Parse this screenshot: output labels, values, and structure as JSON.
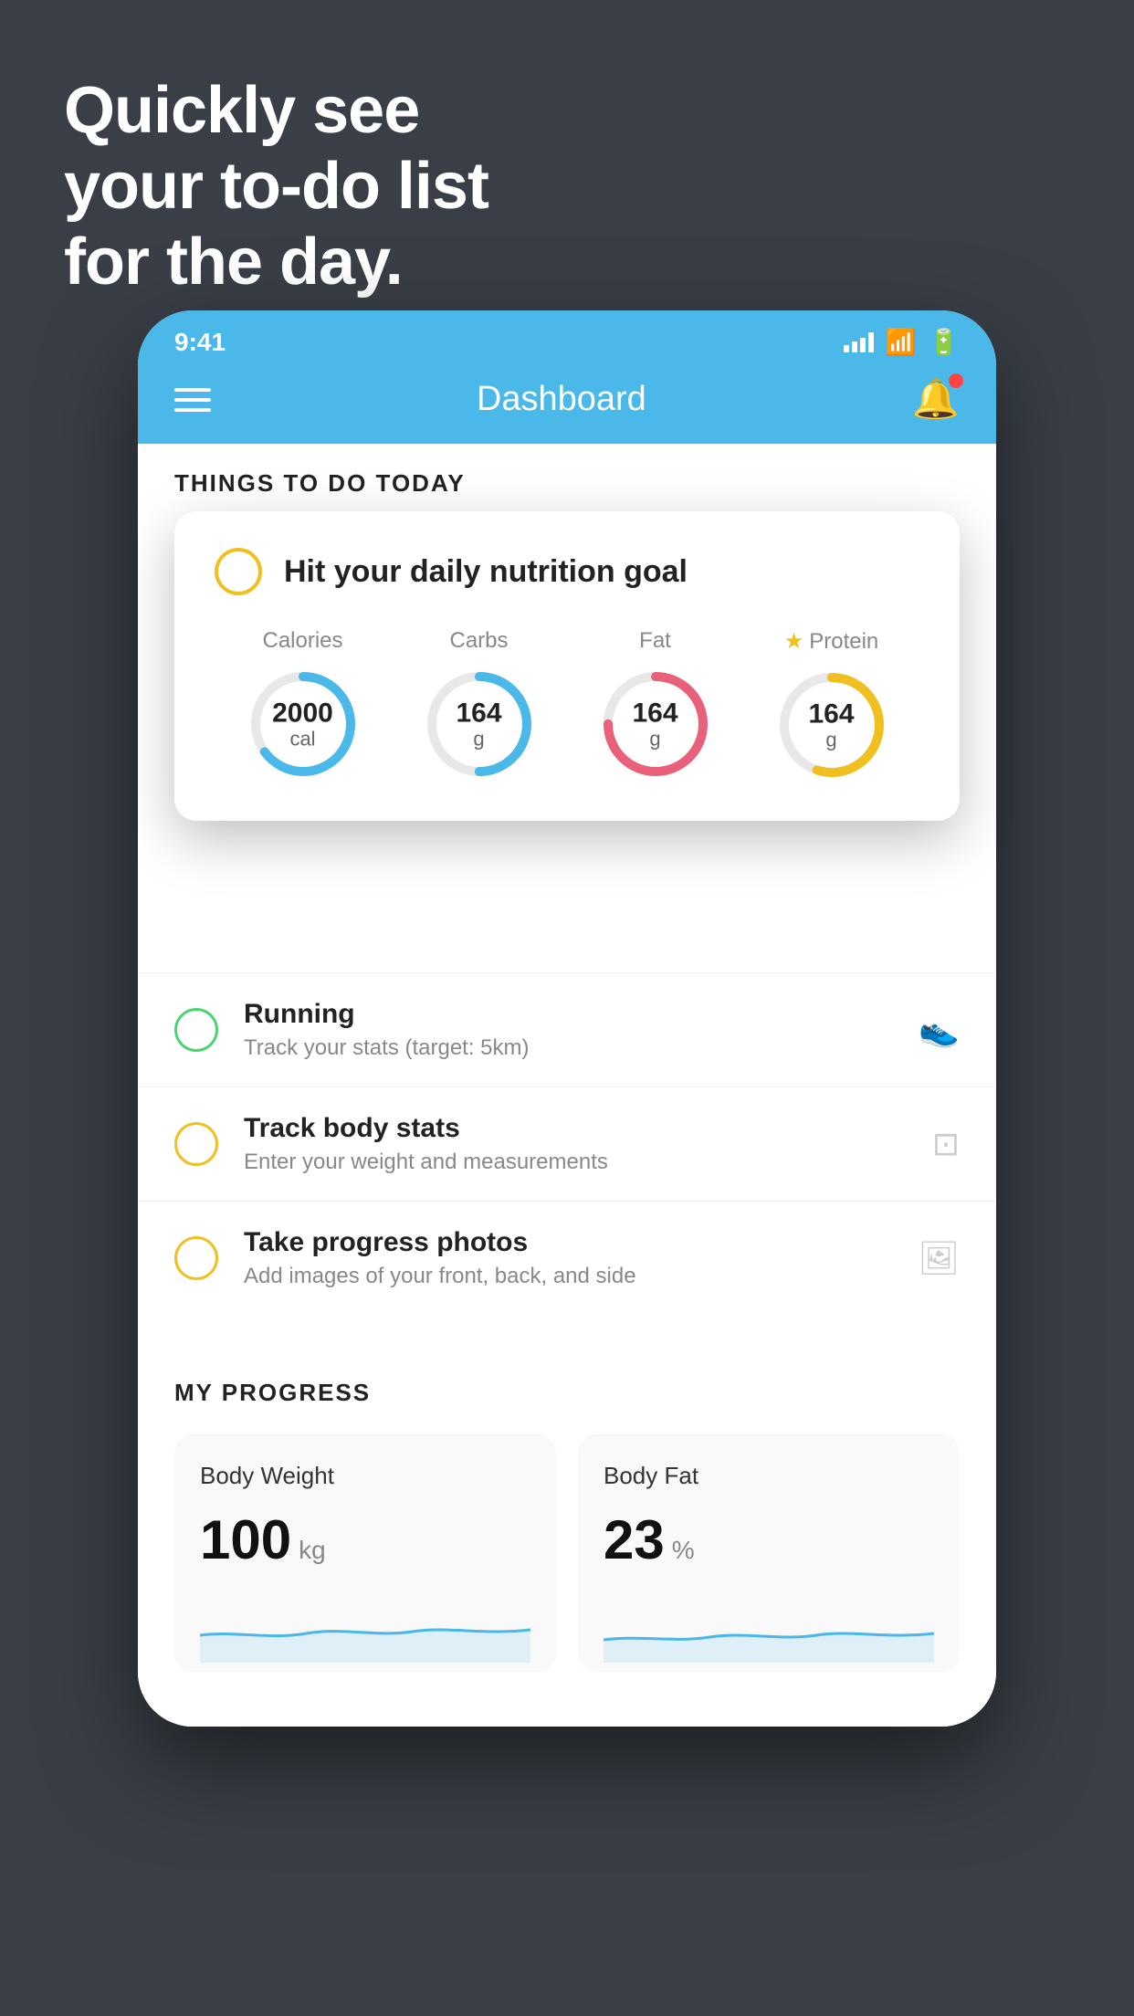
{
  "hero": {
    "line1": "Quickly see",
    "line2": "your to-do list",
    "line3": "for the day."
  },
  "statusBar": {
    "time": "9:41"
  },
  "navBar": {
    "title": "Dashboard"
  },
  "thingsToDo": {
    "heading": "THINGS TO DO TODAY"
  },
  "nutritionCard": {
    "title": "Hit your daily nutrition goal",
    "items": [
      {
        "label": "Calories",
        "value": "2000",
        "unit": "cal",
        "color": "#4ab8e8",
        "percent": 65,
        "starred": false
      },
      {
        "label": "Carbs",
        "value": "164",
        "unit": "g",
        "color": "#4ab8e8",
        "percent": 50,
        "starred": false
      },
      {
        "label": "Fat",
        "value": "164",
        "unit": "g",
        "color": "#e8607a",
        "percent": 75,
        "starred": false
      },
      {
        "label": "Protein",
        "value": "164",
        "unit": "g",
        "color": "#f0c020",
        "percent": 55,
        "starred": true
      }
    ]
  },
  "todoItems": [
    {
      "label": "Running",
      "sub": "Track your stats (target: 5km)",
      "circleColor": "green",
      "iconType": "shoe"
    },
    {
      "label": "Track body stats",
      "sub": "Enter your weight and measurements",
      "circleColor": "yellow",
      "iconType": "scale"
    },
    {
      "label": "Take progress photos",
      "sub": "Add images of your front, back, and side",
      "circleColor": "yellow",
      "iconType": "photo"
    }
  ],
  "progress": {
    "heading": "MY PROGRESS",
    "cards": [
      {
        "title": "Body Weight",
        "value": "100",
        "unit": "kg"
      },
      {
        "title": "Body Fat",
        "value": "23",
        "unit": "%"
      }
    ]
  }
}
